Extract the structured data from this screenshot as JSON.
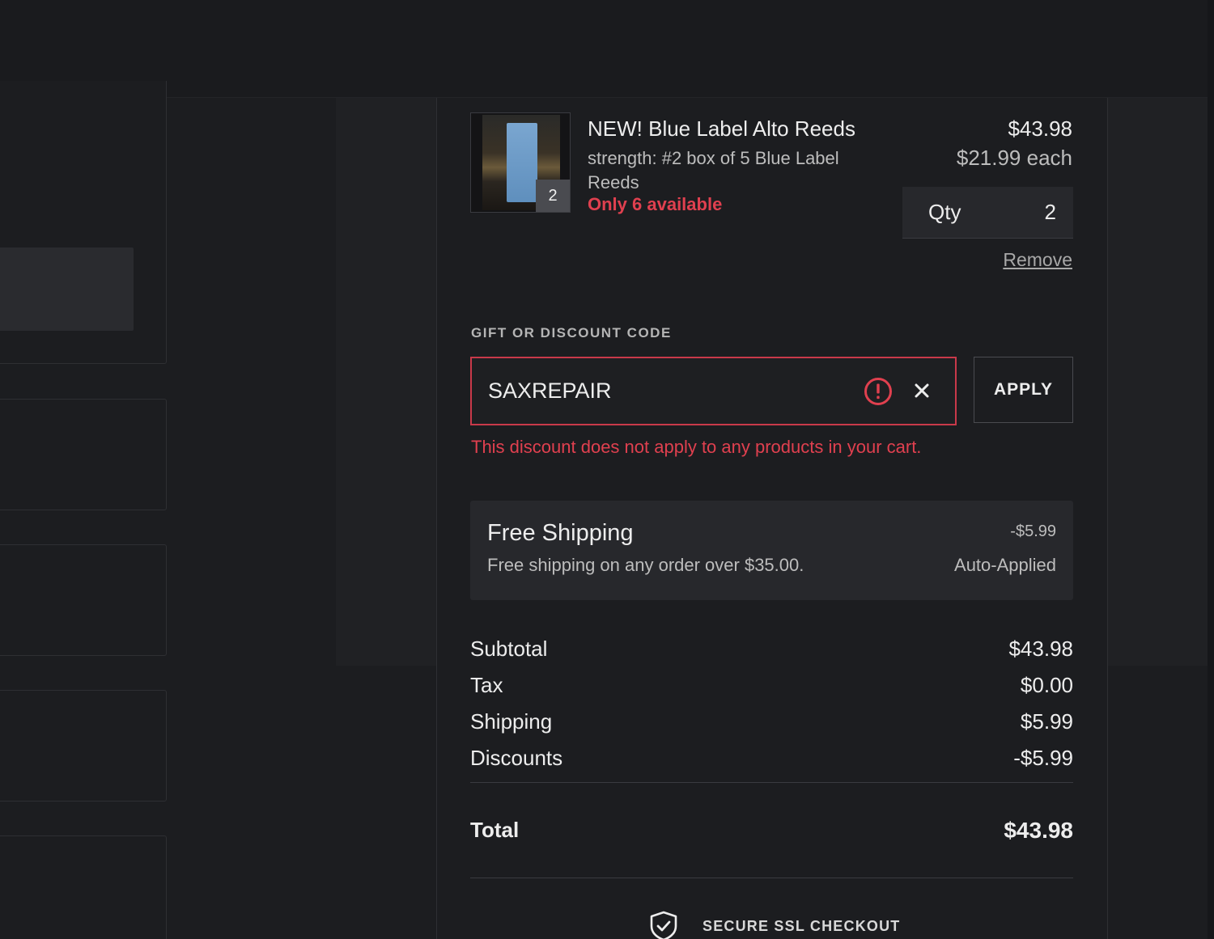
{
  "product": {
    "title": "NEW! Blue Label Alto Reeds",
    "variant": "strength: #2 box of 5 Blue Label Reeds",
    "stock_note": "Only 6 available",
    "thumb_qty": "2",
    "line_total": "$43.98",
    "unit_price": "$21.99 each",
    "qty_label": "Qty",
    "qty_value": "2",
    "remove_label": "Remove"
  },
  "discount": {
    "label": "GIFT OR DISCOUNT CODE",
    "code_value": "SAXREPAIR",
    "apply_label": "APPLY",
    "error": "This discount does not apply to any products in your cart."
  },
  "promo": {
    "title": "Free Shipping",
    "description": "Free shipping on any order over $35.00.",
    "amount": "-$5.99",
    "status": "Auto-Applied"
  },
  "totals": {
    "rows": [
      {
        "label": "Subtotal",
        "value": "$43.98"
      },
      {
        "label": "Tax",
        "value": "$0.00"
      },
      {
        "label": "Shipping",
        "value": "$5.99"
      },
      {
        "label": "Discounts",
        "value": "-$5.99"
      }
    ],
    "total_label": "Total",
    "total_value": "$43.98"
  },
  "secure": {
    "label": "SECURE SSL CHECKOUT",
    "icon": "shield-check-icon"
  },
  "colors": {
    "background": "#1c1d20",
    "error": "#e0404f",
    "input_error_border": "#c9394a"
  }
}
